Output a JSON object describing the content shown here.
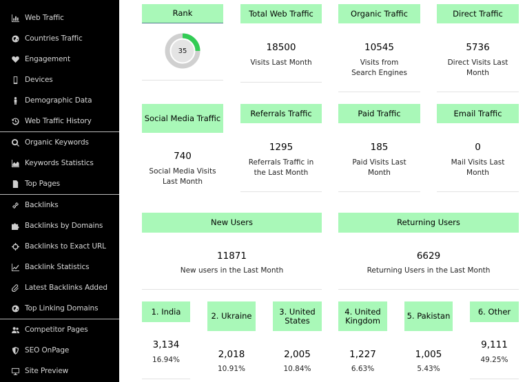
{
  "sidebar": {
    "items": [
      {
        "label": "Web Traffic",
        "icon": "bar-chart-icon"
      },
      {
        "label": "Countries Traffic",
        "icon": "globe-icon"
      },
      {
        "label": "Engagement",
        "icon": "heart-icon"
      },
      {
        "label": "Devices",
        "icon": "mobile-icon"
      },
      {
        "label": "Demographic Data",
        "icon": "person-icon"
      },
      {
        "label": "Web Traffic History",
        "icon": "history-icon"
      },
      {
        "label": "Organic Keywords",
        "icon": "search-icon"
      },
      {
        "label": "Keywords Statistics",
        "icon": "area-chart-icon"
      },
      {
        "label": "Top Pages",
        "icon": "page-icon"
      },
      {
        "label": "Backlinks",
        "icon": "link-icon"
      },
      {
        "label": "Backlinks by Domains",
        "icon": "puzzle-icon"
      },
      {
        "label": "Backlinks to Exact URL",
        "icon": "crosshairs-icon"
      },
      {
        "label": "Backlink Statistics",
        "icon": "line-chart-icon"
      },
      {
        "label": "Latest Backlinks Added",
        "icon": "paperclip-icon"
      },
      {
        "label": "Top Linking Domains",
        "icon": "globe-icon"
      },
      {
        "label": "Competitor Pages",
        "icon": "users-icon"
      },
      {
        "label": "SEO OnPage",
        "icon": "shield-icon"
      },
      {
        "label": "Site Preview",
        "icon": "desktop-icon"
      }
    ]
  },
  "rank": {
    "label": "Rank",
    "value": "35",
    "fill_fraction": 0.25,
    "color": "#33cc55"
  },
  "row1": [
    {
      "label": "Total Web Traffic",
      "value": "18500",
      "caption": "Visits Last Month"
    },
    {
      "label": "Organic Traffic",
      "value": "10545",
      "caption": "Visits from Search Engines"
    },
    {
      "label": "Direct Traffic",
      "value": "5736",
      "caption": "Direct Visits Last Month"
    }
  ],
  "row2": [
    {
      "label": "Social Media Traffic",
      "value": "740",
      "caption": "Social Media Visits Last Month"
    },
    {
      "label": "Referrals Traffic",
      "value": "1295",
      "caption": "Referrals Traffic in the Last Month"
    },
    {
      "label": "Paid Traffic",
      "value": "185",
      "caption": "Paid Visits Last Month"
    },
    {
      "label": "Email Traffic",
      "value": "0",
      "caption": "Mail Visits Last Month"
    }
  ],
  "users": [
    {
      "label": "New Users",
      "value": "11871",
      "caption": "New users in the Last Month"
    },
    {
      "label": "Returning Users",
      "value": "6629",
      "caption": "Returning Users in the Last Month"
    }
  ],
  "countries": [
    {
      "label": "1. India",
      "value": "3,134",
      "percent": "16.94%"
    },
    {
      "label": "2. Ukraine",
      "value": "2,018",
      "percent": "10.91%"
    },
    {
      "label": "3. United States",
      "value": "2,005",
      "percent": "10.84%"
    },
    {
      "label": "4. United Kingdom",
      "value": "1,227",
      "percent": "6.63%"
    },
    {
      "label": "5. Pakistan",
      "value": "1,005",
      "percent": "5.43%"
    },
    {
      "label": "6. Other",
      "value": "9,111",
      "percent": "49.25%"
    }
  ],
  "colors": {
    "header_bg": "#a9f8b8",
    "sidebar_bg": "#000000"
  }
}
